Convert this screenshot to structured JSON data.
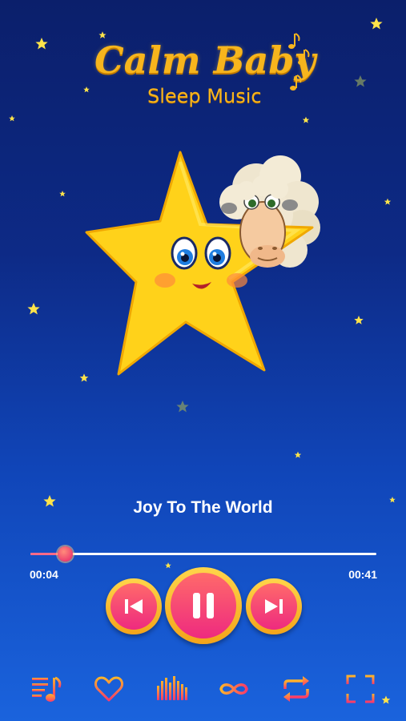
{
  "app": {
    "title": "Calm Baby",
    "subtitle": "Sleep Music"
  },
  "player": {
    "song_title": "Joy To The World",
    "current_time": "00:04",
    "total_time": "00:41",
    "progress": 0.1,
    "state": "playing"
  },
  "controls": {
    "previous_icon": "skip-previous-icon",
    "pause_icon": "pause-icon",
    "next_icon": "skip-next-icon"
  },
  "toolbar": {
    "items": [
      {
        "icon": "playlist-icon"
      },
      {
        "icon": "heart-icon"
      },
      {
        "icon": "equalizer-icon"
      },
      {
        "icon": "infinity-icon"
      },
      {
        "icon": "repeat-icon"
      },
      {
        "icon": "fullscreen-icon"
      }
    ]
  },
  "colors": {
    "background_top": "#0b1f6b",
    "background_bottom": "#1a63dd",
    "accent_gold": "#f7b51d",
    "accent_pink": "#ee2a7f"
  }
}
